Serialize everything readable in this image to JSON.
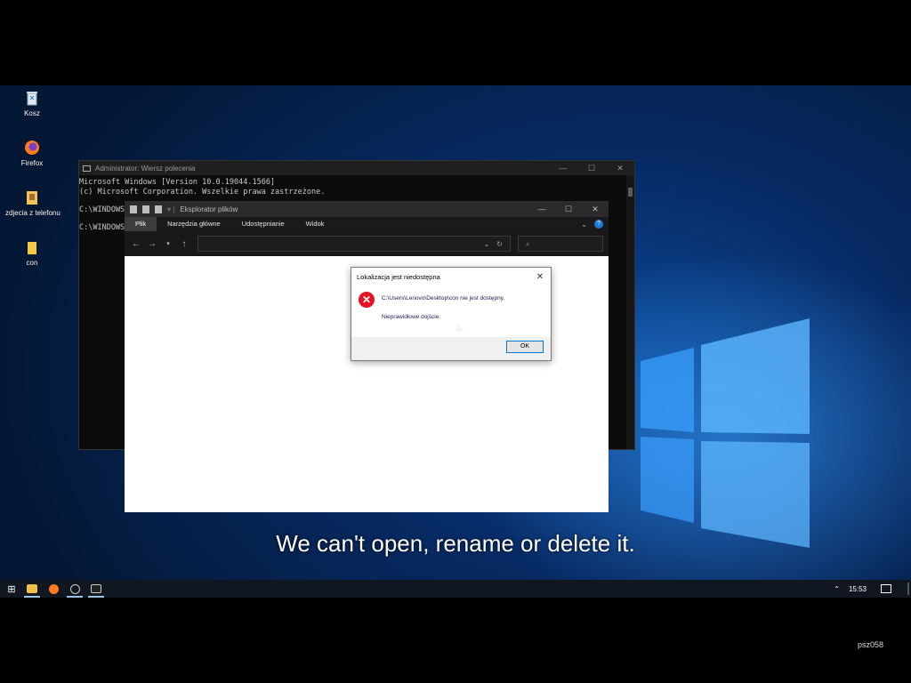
{
  "desktop": {
    "icons": [
      {
        "label": "Kosz",
        "icon": "recycle-bin-icon"
      },
      {
        "label": "Firefox",
        "icon": "firefox-icon"
      },
      {
        "label": "zdjecia z telefonu",
        "icon": "folder-icon"
      },
      {
        "label": "con",
        "icon": "folder-icon"
      }
    ]
  },
  "cmd": {
    "title": "Administrator: Wiersz polecenia",
    "lines": [
      "Microsoft Windows [Version 10.0.19044.1566]",
      "(c) Microsoft Corporation. Wszelkie prawa zastrzeżone."
    ],
    "prompt1": "C:\\WINDOWS",
    "prompt2": "C:\\WINDOWS"
  },
  "explorer": {
    "title": "Eksplorator plików",
    "ribbon_tabs": [
      "Plik",
      "Narzędzia główne",
      "Udostępnianie",
      "Widok"
    ]
  },
  "dialog": {
    "title": "Lokalizacja jest niedostępna",
    "message": "C:\\Users\\Lenovo\\Desktop\\con nie jest dostępny.",
    "detail": "Nieprawidłowe dojście.",
    "ok_label": "OK"
  },
  "subtitle": "We can't open, rename or delete it.",
  "taskbar": {
    "clock": "15:53",
    "items": [
      "file-explorer-icon",
      "firefox-icon",
      "settings-icon",
      "cmd-icon"
    ]
  },
  "watermark": "psz058",
  "colors": {
    "error": "#e81123",
    "accent": "#0078d7",
    "taskbar": "#101720"
  }
}
